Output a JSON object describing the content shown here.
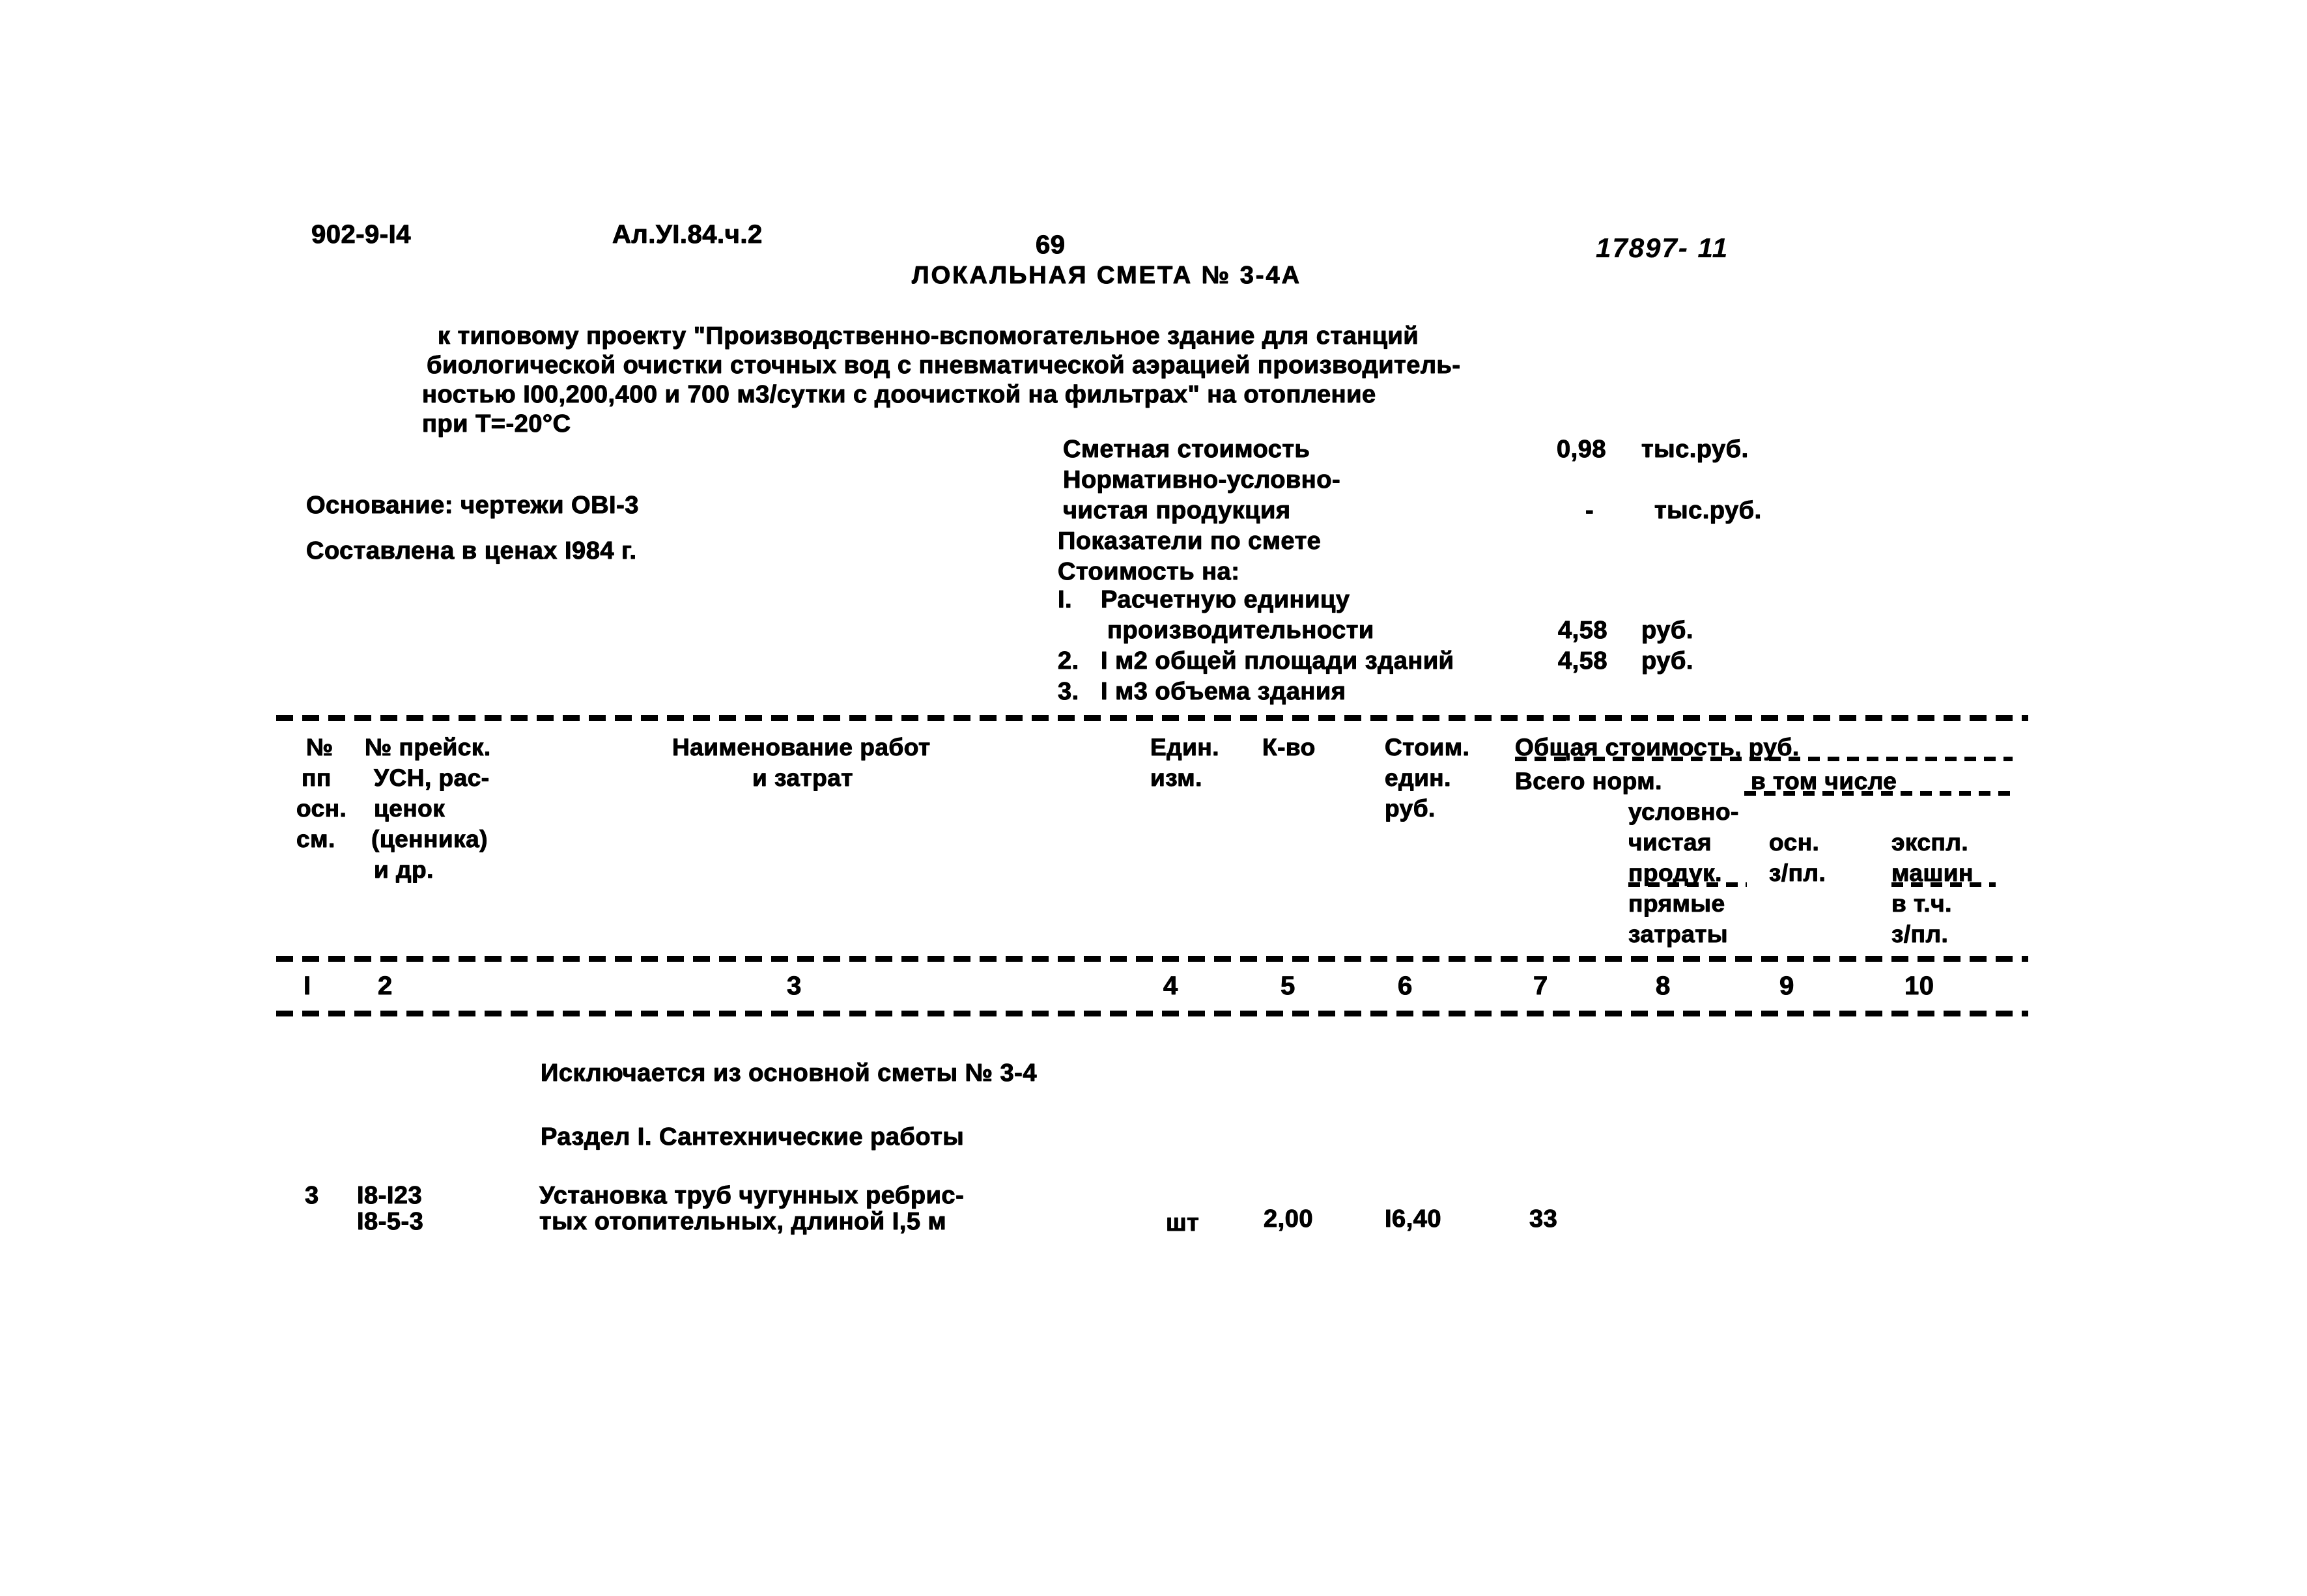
{
  "document": {
    "project_code": "902-9-I4",
    "album_code": "Ал.УI.84.ч.2",
    "page_number": "69",
    "archive_stamp": "17897- 11",
    "title": "ЛОКАЛЬНАЯ СМЕТА № 3-4А",
    "subtitle_lines": [
      "к типовому проекту \"Производственно-вспомогательное здание для станций",
      "биологической очистки сточных вод с пневматической аэрацией производитель-",
      "ностью I00,200,400 и 700 м3/сутки с доочисткой на фильтрах\" на отопление",
      "при Т=-20°С"
    ]
  },
  "basis": {
    "basis_label": "Основание: чертежи ОВI-3",
    "prices_label": "Составлена в ценах I984 г."
  },
  "summary": {
    "rows": [
      {
        "label": "Сметная стоимость",
        "value": "0,98",
        "unit": "тыс.руб."
      },
      {
        "label": "Нормативно-условно-",
        "value": "",
        "unit": ""
      },
      {
        "label": "чистая продукция",
        "value": "-",
        "unit": "тыс.руб."
      },
      {
        "label": "Показатели по смете",
        "value": "",
        "unit": ""
      },
      {
        "label": "Стоимость на:",
        "value": "",
        "unit": ""
      }
    ],
    "indicators": [
      {
        "num": "I.",
        "label": "Расчетную единицу",
        "label2": "производительности",
        "value": "4,58",
        "unit": "руб."
      },
      {
        "num": "2.",
        "label": "I м2 общей площади зданий",
        "label2": "",
        "value": "4,58",
        "unit": "руб."
      },
      {
        "num": "3.",
        "label": "I м3 объема здания",
        "label2": "",
        "value": "",
        "unit": ""
      }
    ]
  },
  "table": {
    "header": {
      "col1": [
        "№",
        "пп",
        "осн.",
        "см."
      ],
      "col2": [
        "№ прейск.",
        "УСН, рас-",
        "ценок",
        "(ценника)",
        "и др."
      ],
      "col3": [
        "Наименование работ",
        "и затрат"
      ],
      "col4": [
        "Един.",
        "изм."
      ],
      "col5": [
        "К-во"
      ],
      "col6": [
        "Стоим.",
        "един.",
        "руб."
      ],
      "group_total": "Общая стоимость, руб.",
      "col7": [
        "Всего норм."
      ],
      "group_included": "в том числе",
      "col8": [
        "условно-",
        "чистая",
        "продук.",
        "прямые",
        "затраты"
      ],
      "col9": [
        "осн.",
        "з/пл."
      ],
      "col10": [
        "экспл.",
        "машин",
        "в т.ч.",
        "з/пл."
      ]
    },
    "column_numbers": [
      "I",
      "2",
      "3",
      "4",
      "5",
      "6",
      "7",
      "8",
      "9",
      "10"
    ],
    "notes": [
      "Исключается из основной сметы № 3-4",
      "Раздел I. Сантехнические работы"
    ],
    "rows": [
      {
        "c1": "3",
        "c2_line1": "I8-I23",
        "c2_line2": "I8-5-3",
        "c3_line1": "Установка труб чугунных ребрис-",
        "c3_line2": "тых отопительных, длиной I,5 м",
        "c4": "шт",
        "c5": "2,00",
        "c6": "I6,40",
        "c7": "33",
        "c8": "",
        "c9": "",
        "c10": ""
      }
    ]
  }
}
